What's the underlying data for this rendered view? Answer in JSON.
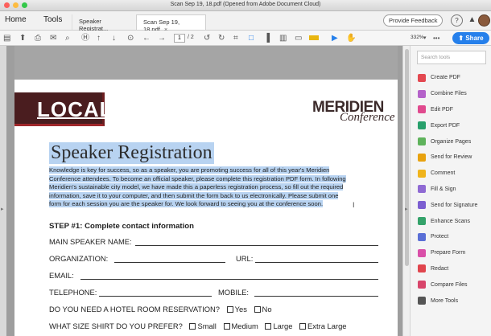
{
  "window": {
    "title": "Scan Sep 19, 18.pdf (Opened from Adobe Document Cloud)"
  },
  "tabs": {
    "home": "Home",
    "tools": "Tools",
    "doc1": "Speaker Registrat...",
    "doc2": "Scan Sep 19, 18.pdf",
    "close": "×"
  },
  "header": {
    "feedback": "Provide Feedback",
    "help": "?",
    "bell": "🔔"
  },
  "toolbar": {
    "page_current": "1",
    "page_total": "/ 2",
    "zoom": "332%",
    "more": "•••",
    "share": "Share",
    "icons": [
      "sidebar-icon",
      "upload-icon",
      "print-icon",
      "mail-icon",
      "search-icon",
      "hand-icon",
      "up-arrow-icon",
      "down-arrow-icon",
      "prev-icon",
      "next-icon",
      "rotate-ccw-icon",
      "rotate-cw-icon",
      "crop-icon",
      "doc-icon",
      "columns-icon",
      "grid-icon",
      "screen-icon",
      "highlight-icon",
      "select-icon",
      "pan-icon"
    ],
    "highlight_color": "#e8b50f",
    "share_color": "#2680eb"
  },
  "document": {
    "banner": "LOCAL",
    "brand_top": "MERIDIEN",
    "brand_bottom": "Conference",
    "heading": "Speaker Registration",
    "intro_lines": [
      "Knowledge is key for success, so as a speaker, you are promoting success for all of this year's Meridien",
      "Conference attendees. To become an official speaker, please complete this registration PDF form. In following",
      "Meridien's sustainable city model, we have made this a paperless registration process, so fill out the required",
      "information, save it to your computer, and then submit the form back to us electronically. Please submit one",
      "form for each session you are the speaker for. We look forward to seeing you at the conference soon."
    ],
    "step": "STEP #1: Complete contact information",
    "fields": {
      "speaker": "MAIN SPEAKER NAME:",
      "org": "ORGANIZATION:",
      "url": "URL:",
      "email": "EMAIL:",
      "phone": "TELEPHONE:",
      "mobile": "MOBILE:",
      "hotel": "DO YOU NEED A HOTEL ROOM RESERVATION?",
      "yes": "Yes",
      "no": "No",
      "shirt": "WHAT SIZE SHIRT DO YOU PREFER?",
      "small": "Small",
      "medium": "Medium",
      "large": "Large",
      "xlarge": "Extra Large"
    },
    "selection_color": "#b8d3f1"
  },
  "rightpane": {
    "search_placeholder": "Search tools",
    "tools": [
      {
        "label": "Create PDF",
        "color": "#e34850"
      },
      {
        "label": "Combine Files",
        "color": "#b462c9"
      },
      {
        "label": "Edit PDF",
        "color": "#e04a8e"
      },
      {
        "label": "Export PDF",
        "color": "#28a06c"
      },
      {
        "label": "Organize Pages",
        "color": "#5fb35c"
      },
      {
        "label": "Send for Review",
        "color": "#e8a20f"
      },
      {
        "label": "Comment",
        "color": "#f0b41c"
      },
      {
        "label": "Fill & Sign",
        "color": "#8f6ad3"
      },
      {
        "label": "Send for Signature",
        "color": "#7c5fd1"
      },
      {
        "label": "Enhance Scans",
        "color": "#34a26a"
      },
      {
        "label": "Protect",
        "color": "#5a6fd6"
      },
      {
        "label": "Prepare Form",
        "color": "#d94fa8"
      },
      {
        "label": "Redact",
        "color": "#e0454d"
      },
      {
        "label": "Compare Files",
        "color": "#d8456b"
      },
      {
        "label": "More Tools",
        "color": "#555555"
      }
    ]
  }
}
